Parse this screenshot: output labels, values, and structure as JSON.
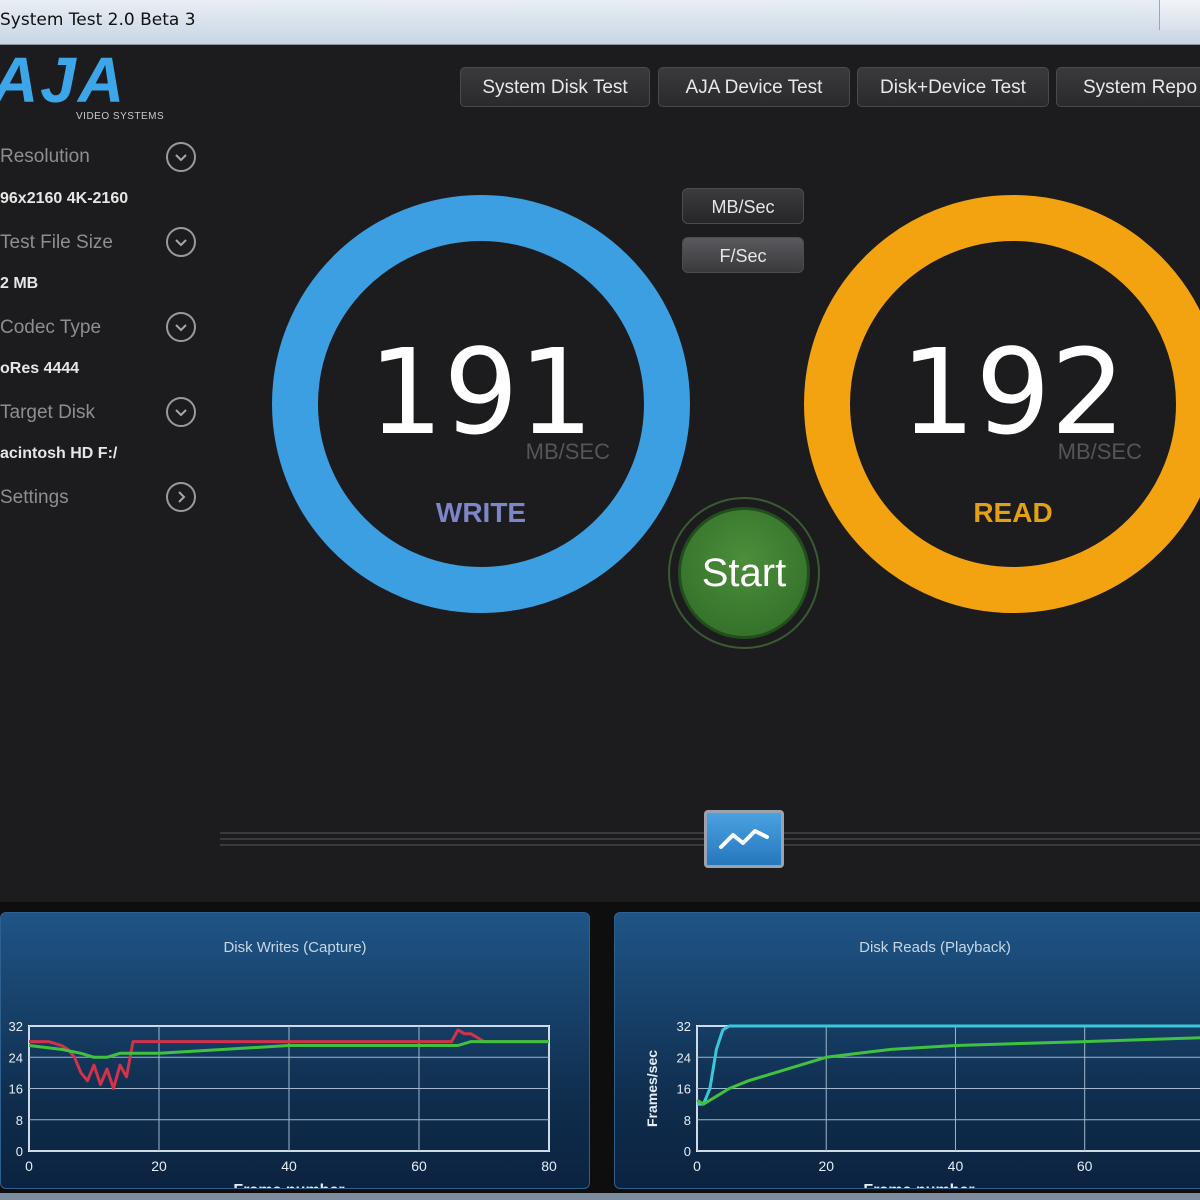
{
  "window": {
    "title": "System Test 2.0 Beta 3"
  },
  "logo": {
    "brand": "AJA",
    "subtitle": "VIDEO SYSTEMS",
    "color": "#3da6e8"
  },
  "tabs": [
    {
      "label": "System Disk Test"
    },
    {
      "label": "AJA Device Test"
    },
    {
      "label": "Disk+Device Test"
    },
    {
      "label": "System Repo"
    }
  ],
  "sidebar": [
    {
      "label": "Resolution",
      "value": "96x2160 4K-2160",
      "icon": "chevron-down-icon"
    },
    {
      "label": "Test File Size",
      "value": "2 MB",
      "icon": "chevron-down-icon"
    },
    {
      "label": "Codec Type",
      "value": "oRes 4444",
      "icon": "chevron-down-icon"
    },
    {
      "label": "Target Disk",
      "value": "acintosh HD F:/",
      "icon": "chevron-down-icon"
    },
    {
      "label": "Settings",
      "value": "",
      "icon": "chevron-right-icon"
    }
  ],
  "units": {
    "mbsec": "MB/Sec",
    "fsec": "F/Sec"
  },
  "write": {
    "value": "191",
    "unit": "MB/SEC",
    "label": "WRITE",
    "ring_color": "#3b9fe2",
    "label_color": "#7d86c8"
  },
  "read": {
    "value": "192",
    "unit": "MB/SEC",
    "label": "READ",
    "ring_color": "#f2a30f",
    "label_color": "#e3a012"
  },
  "start": {
    "label": "Start"
  },
  "graph_toggle": {
    "icon": "line-graph-icon"
  },
  "charts": [
    {
      "title": "Disk Writes (Capture)",
      "chart_data": {
        "type": "line",
        "title": "Disk Writes (Capture)",
        "xlabel": "Frame number",
        "ylabel": "",
        "xlim": [
          0,
          80
        ],
        "ylim": [
          0,
          32
        ],
        "xticks": [
          "0",
          "20",
          "40",
          "60",
          "80"
        ],
        "yticks": [
          "0",
          "8",
          "16",
          "24",
          "32"
        ],
        "series": [
          {
            "color": "#d2324a",
            "x": [
              0,
              3,
              5,
              6,
              7,
              8,
              9,
              10,
              11,
              12,
              13,
              14,
              15,
              16,
              20,
              40,
              60,
              65,
              66,
              67,
              68,
              70,
              80
            ],
            "y": [
              28,
              28,
              27,
              26,
              24,
              20,
              18,
              22,
              17,
              21,
              16,
              22,
              19,
              28,
              28,
              28,
              28,
              28,
              31,
              30,
              30,
              28,
              28
            ]
          },
          {
            "color": "#3fc23f",
            "x": [
              0,
              5,
              8,
              10,
              12,
              14,
              16,
              20,
              30,
              40,
              60,
              66,
              68,
              80
            ],
            "y": [
              27,
              26,
              25,
              24,
              24,
              25,
              25,
              25,
              26,
              27,
              27,
              27,
              28,
              28
            ]
          }
        ]
      }
    },
    {
      "title": "Disk Reads (Playback)",
      "chart_data": {
        "type": "line",
        "title": "Disk Reads (Playback)",
        "xlabel": "Frame number",
        "ylabel": "Frames/sec",
        "xlim": [
          0,
          78
        ],
        "ylim": [
          0,
          32
        ],
        "xticks": [
          "0",
          "20",
          "40",
          "60"
        ],
        "yticks": [
          "0",
          "8",
          "16",
          "24",
          "32"
        ],
        "series": [
          {
            "color": "#39c8d8",
            "x": [
              0,
              1,
              2,
              3,
              4,
              5,
              10,
              20,
              40,
              60,
              78
            ],
            "y": [
              12,
              12,
              16,
              26,
              31,
              32,
              32,
              32,
              32,
              32,
              32
            ]
          },
          {
            "color": "#3fc23f",
            "x": [
              0,
              1,
              3,
              5,
              8,
              12,
              16,
              20,
              25,
              30,
              40,
              60,
              78
            ],
            "y": [
              13,
              12,
              14,
              16,
              18,
              20,
              22,
              24,
              25,
              26,
              27,
              28,
              29
            ]
          }
        ]
      }
    }
  ]
}
